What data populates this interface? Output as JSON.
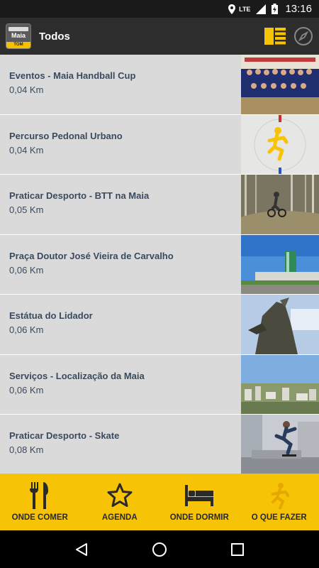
{
  "status_bar": {
    "time": "13:16",
    "network": "LTE"
  },
  "app_bar": {
    "logo_name": "Maia",
    "logo_badge": "TOM",
    "title": "Todos"
  },
  "items": [
    {
      "title": "Eventos - Maia Handball Cup",
      "distance": "0,04 Km"
    },
    {
      "title": "Percurso Pedonal Urbano",
      "distance": "0,04 Km"
    },
    {
      "title": "Praticar Desporto - BTT na Maia",
      "distance": "0,05 Km"
    },
    {
      "title": "Praça Doutor José Vieira de Carvalho",
      "distance": "0,06 Km"
    },
    {
      "title": "Estátua do Lidador",
      "distance": "0,06 Km"
    },
    {
      "title": "Serviços - Localização da Maia",
      "distance": "0,06 Km"
    },
    {
      "title": "Praticar Desporto - Skate",
      "distance": "0,08 Km"
    }
  ],
  "tabs": [
    {
      "label": "ONDE COMER",
      "icon": "fork-knife-icon"
    },
    {
      "label": "AGENDA",
      "icon": "star-icon"
    },
    {
      "label": "ONDE DORMIR",
      "icon": "bed-icon"
    },
    {
      "label": "O QUE FAZER",
      "icon": "runner-icon"
    }
  ],
  "colors": {
    "accent": "#f7c307",
    "app_bar": "#2d2d2d",
    "list_bg": "#dadada",
    "text": "#3a4a5e"
  }
}
